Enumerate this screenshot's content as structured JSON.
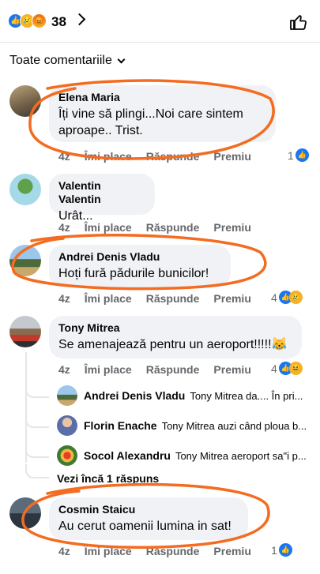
{
  "header": {
    "reaction_count": "38",
    "reactions": [
      "like-icon",
      "sad-icon",
      "angry-icon"
    ]
  },
  "sort": {
    "label": "Toate comentariile"
  },
  "actions": {
    "like": "Îmi place",
    "reply": "Răspunde",
    "premium": "Premiu"
  },
  "comments": [
    {
      "author": "Elena Maria",
      "text": "Îți vine să plingi...Noi care sintem aproape.. Trist.",
      "time": "4z",
      "reaction_count": "1",
      "reactions": [
        "like-icon"
      ]
    },
    {
      "author": "Valentin Valentin",
      "text": "Urât...",
      "time": "4z",
      "reaction_count": "",
      "reactions": []
    },
    {
      "author": "Andrei Denis Vladu",
      "text": "Hoți fură pădurile bunicilor!",
      "time": "4z",
      "reaction_count": "4",
      "reactions": [
        "like-icon",
        "sad-icon"
      ]
    },
    {
      "author": "Tony Mitrea",
      "text": "Se amenajează pentru un aeroport!!!!!😹",
      "time": "4z",
      "reaction_count": "4",
      "reactions": [
        "like-icon",
        "haha-icon"
      ]
    },
    {
      "author": "Cosmin Staicu",
      "text": "Au cerut oamenii lumina in sat!",
      "time": "4z",
      "reaction_count": "1",
      "reactions": [
        "like-icon"
      ]
    }
  ],
  "replies": [
    {
      "author": "Andrei Denis Vladu",
      "snippet": "Tony Mitrea da.... În pri..."
    },
    {
      "author": "Florin Enache",
      "snippet": "Tony Mitrea auzi când ploua b..."
    },
    {
      "author": "Socol Alexandru",
      "snippet": "Tony Mitrea  aeroport sa\"i p..."
    }
  ],
  "more_replies": "Vezi încă 1 răspuns",
  "colors": {
    "accent": "#1877f2",
    "annotation": "#f36c21",
    "bubble": "#f0f2f5"
  }
}
